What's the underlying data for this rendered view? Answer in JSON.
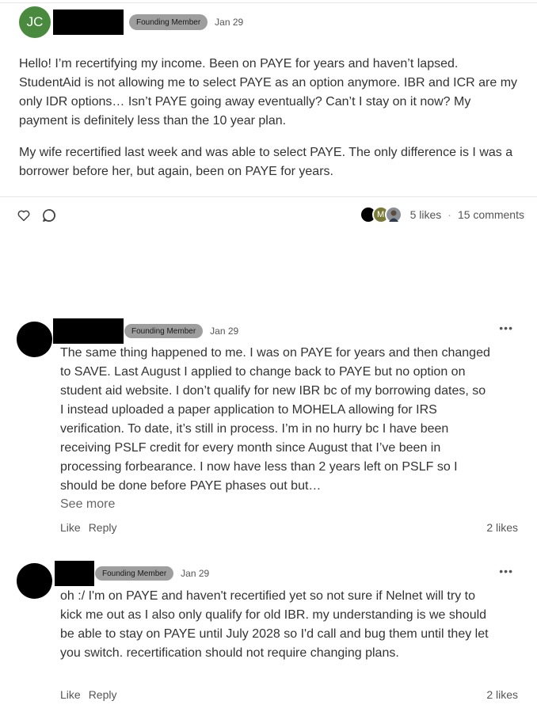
{
  "post": {
    "author_initials": "JC",
    "badge": "Founding Member",
    "date": "Jan 29",
    "paragraphs": [
      "Hello! I’m recertifying my income. Been on PAYE for years and haven’t lapsed. StudentAid is not allowing me to select PAYE as an option anymore. IBR and ICR are my only IDR options… Isn’t PAYE going away eventually? Can’t I stay on it now? My payment is definitely less than the 10 year plan.",
      "My wife recertified last week and was able to select PAYE. The only difference is I was a borrower before her, but again, been on PAYE for years."
    ],
    "likes": "5 likes",
    "separator": "·",
    "comments": "15 comments",
    "liker_initial": "M"
  },
  "comments": [
    {
      "badge": "Founding Member",
      "date": "Jan 29",
      "text": "The same thing happened to me. I was on PAYE for years and then changed to SAVE. Last August I applied to change back to PAYE but no option on student aid website. I don’t qualify for new IBR bc of my borrowing dates, so I instead uploaded a paper application to MOHELA allowing for IRS verification. To date, it’s still in process. I’m in no hurry bc I have been receiving PSLF credit for every month since August that I’ve been in processing forbearance. I now have less than 2 years left on PSLF so I should be done before PAYE phases out but…",
      "see_more": "See more",
      "like": "Like",
      "reply": "Reply",
      "likes": "2 likes"
    },
    {
      "badge": "Founding Member",
      "date": "Jan 29",
      "text": "oh :/ I'm on PAYE and haven't recertified yet so not sure if Nelnet will try to kick me out as I also only qualify for old IBR. my understanding is we should be able to stay on PAYE until July 2028 so I'd call and bug them until they let you switch. recertification should not require changing plans.",
      "like": "Like",
      "reply": "Reply",
      "likes": "2 likes"
    }
  ],
  "icons": {
    "like": "heart-icon",
    "comment": "comment-bubble-icon",
    "more": "more-options-icon"
  },
  "colors": {
    "avatar_green": "#4a8a3f",
    "badge_gray": "#9e9e9e",
    "redaction": "#000000"
  }
}
